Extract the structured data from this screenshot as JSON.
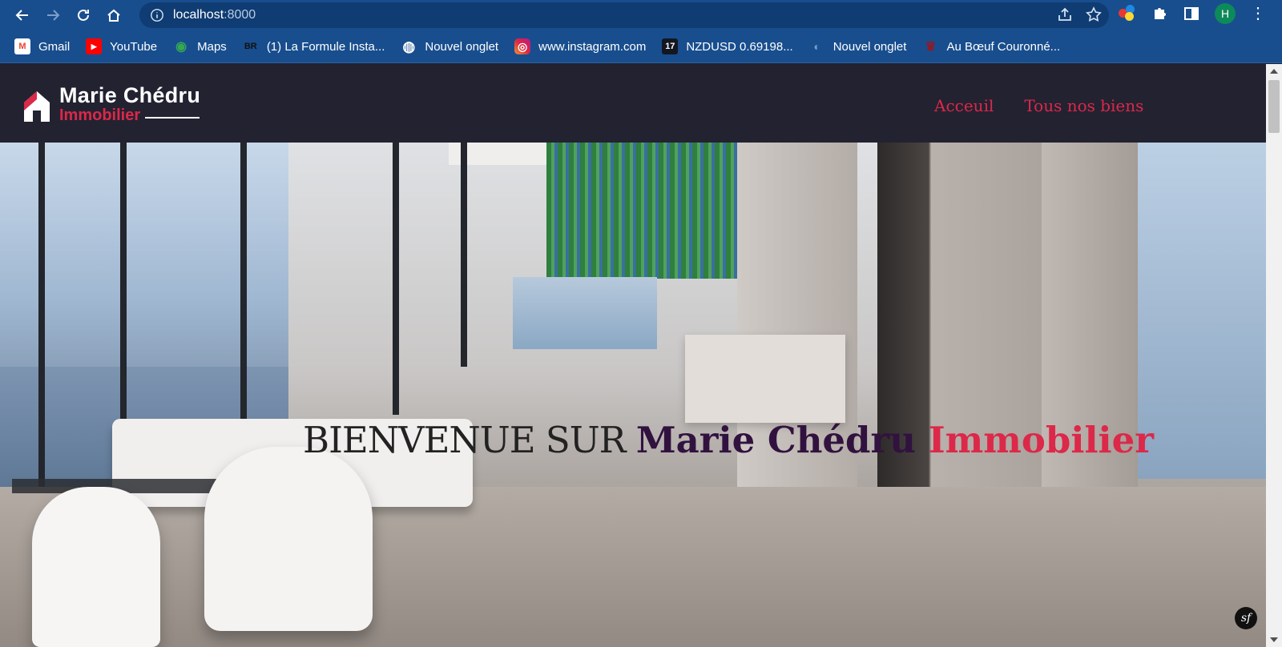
{
  "browser": {
    "url_host": "localhost",
    "url_port": ":8000",
    "avatar_letter": "H",
    "bookmarks": [
      {
        "label": "Gmail",
        "icon": "gmail-icon",
        "color": "#ea4335",
        "glyph": "M"
      },
      {
        "label": "YouTube",
        "icon": "youtube-icon",
        "color": "#ff0000",
        "glyph": "▶"
      },
      {
        "label": "Maps",
        "icon": "maps-icon",
        "color": "#34a853",
        "glyph": "◉"
      },
      {
        "label": "(1) La Formule Insta...",
        "icon": "br-icon",
        "color": "#1b1b1b",
        "glyph": "BR"
      },
      {
        "label": "Nouvel onglet",
        "icon": "globe-icon",
        "color": "#ffffff",
        "glyph": "◍"
      },
      {
        "label": "www.instagram.com",
        "icon": "instagram-icon",
        "color": "#d6249f",
        "glyph": "◎"
      },
      {
        "label": "NZDUSD 0.69198...",
        "icon": "tradingview-icon",
        "color": "#131722",
        "glyph": "17"
      },
      {
        "label": "Nouvel onglet",
        "icon": "tab-icon",
        "color": "#4a6d96",
        "glyph": "◐"
      },
      {
        "label": "Au Bœuf Couronné...",
        "icon": "boeuf-icon",
        "color": "#8b1c2c",
        "glyph": "♛"
      }
    ]
  },
  "site": {
    "logo_line1": "Marie Chédru",
    "logo_line2": "Immobilier",
    "nav": [
      "Acceuil",
      "Tous nos biens"
    ],
    "hero_title_part1": "BIENVENUE SUR ",
    "hero_title_part2": "Marie Chédru ",
    "hero_title_part3": "Immobilier",
    "sf_badge": "sf"
  },
  "colors": {
    "browser_bar": "#184e8e",
    "site_header": "#232231",
    "accent_red": "#dc2849",
    "title_purple": "#31123f"
  }
}
